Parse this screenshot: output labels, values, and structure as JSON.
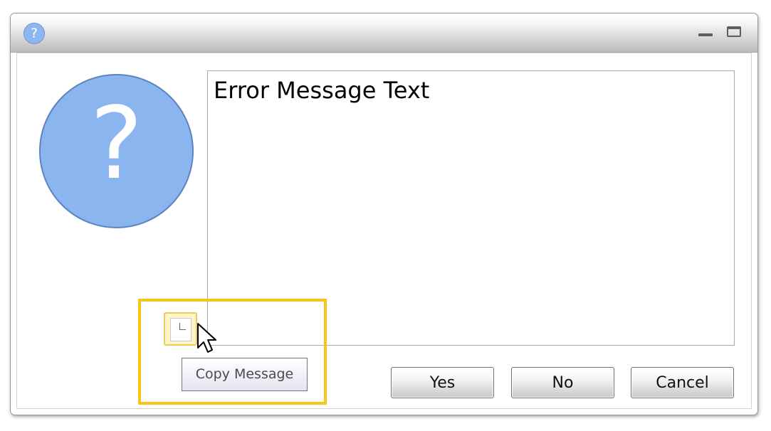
{
  "window": {
    "title_icon": "question-icon",
    "title_icon_glyph": "?"
  },
  "dialog": {
    "icon": "question-mark-icon",
    "icon_glyph": "?",
    "icon_color": "#8ab5ef",
    "message": "Error Message Text"
  },
  "buttons": {
    "yes": "Yes",
    "no": "No",
    "cancel": "Cancel"
  },
  "copy": {
    "icon": "copy-icon",
    "tooltip": "Copy Message",
    "highlight_color": "#f5c518"
  }
}
